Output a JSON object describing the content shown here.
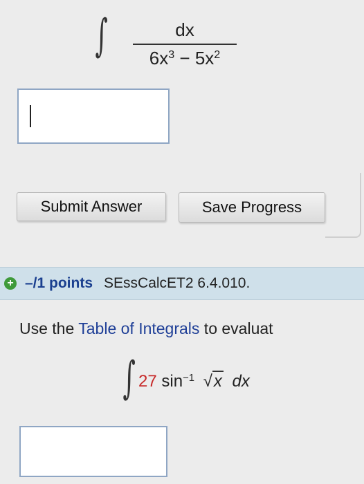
{
  "problem1": {
    "numerator": "dx",
    "denominator": {
      "term1_coef": "6x",
      "term1_exp": "3",
      "op": "−",
      "term2_coef": "5x",
      "term2_exp": "2"
    }
  },
  "buttons": {
    "submit": "Submit Answer",
    "save": "Save Progress"
  },
  "problem2": {
    "points": "–/1 points",
    "code": "SEssCalcET2 6.4.010.",
    "instruction_prefix": "Use the ",
    "instruction_link": "Table of Integrals",
    "instruction_suffix": " to evaluat",
    "integrand": {
      "coef": "27",
      "func": "sin",
      "exp": "−1",
      "radicand": "x",
      "dx": "dx"
    }
  },
  "colors": {
    "accent_blue": "#1f3f97",
    "red": "#c72a2a",
    "green": "#3f9a3a",
    "bar": "#cfe0ea"
  }
}
